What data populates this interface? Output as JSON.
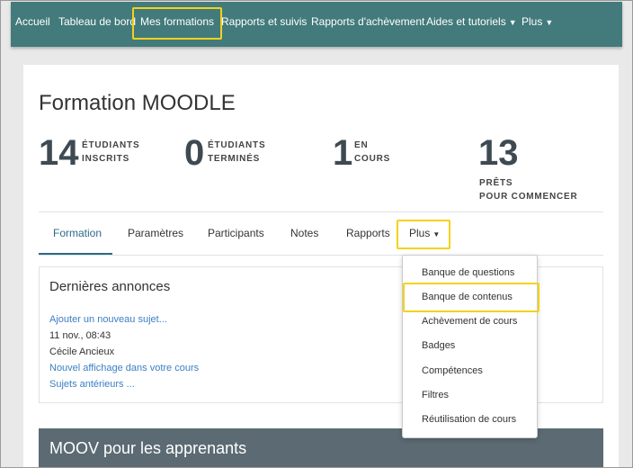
{
  "nav": {
    "items": [
      "Accueil",
      "Tableau de bord",
      "Mes formations",
      "Rapports et suivis",
      "Rapports d'achèvement"
    ],
    "aides": "Aides et tutoriels",
    "plus": "Plus"
  },
  "course": {
    "title": "Formation MOODLE"
  },
  "stats": [
    {
      "num": "14",
      "l1": "ÉTUDIANTS",
      "l2": "INSCRITS"
    },
    {
      "num": "0",
      "l1": "ÉTUDIANTS",
      "l2": "TERMINÉS"
    },
    {
      "num": "1",
      "l1": "EN",
      "l2": "COURS"
    },
    {
      "num": "13",
      "l1": "PRÊTS",
      "l2": "POUR COMMENCER"
    }
  ],
  "tabs": {
    "formation": "Formation",
    "parametres": "Paramètres",
    "participants": "Participants",
    "notes": "Notes",
    "rapports": "Rapports",
    "plus": "Plus"
  },
  "announcements": {
    "title": "Dernières annonces",
    "add": "Ajouter un nouveau sujet...",
    "date": "11 nov., 08:43",
    "author": "Cécile Ancieux",
    "post": "Nouvel affichage dans votre cours",
    "older": "Sujets antérieurs ..."
  },
  "dropdown": [
    "Banque de questions",
    "Banque de contenus",
    "Achèvement de cours",
    "Badges",
    "Compétences",
    "Filtres",
    "Réutilisation de cours"
  ],
  "section": {
    "title": "MOOV pour les apprenants"
  },
  "colors": {
    "navbar": "#437a7b",
    "highlight": "#f2d21b",
    "link": "#3b7fc4",
    "section": "#5b6a73"
  }
}
